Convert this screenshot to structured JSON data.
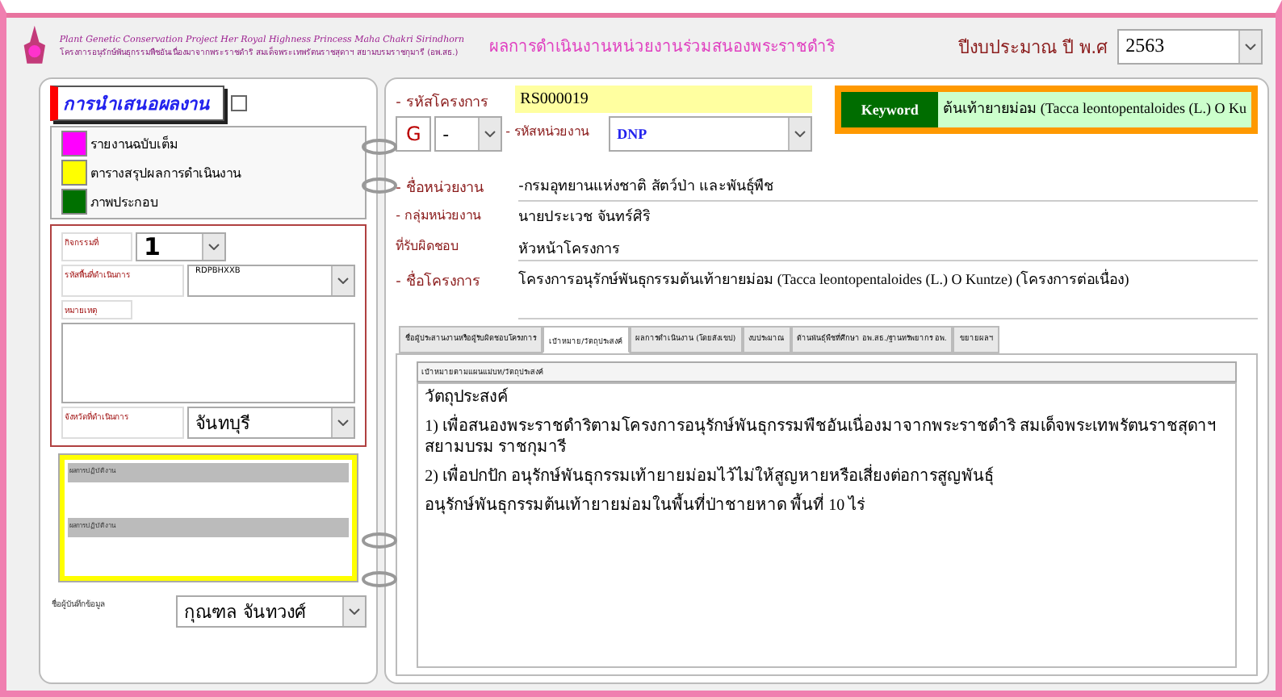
{
  "header": {
    "title_en": "Plant Genetic Conservation Project    Her Royal Highness Princess Maha Chakri Sirindhorn",
    "title_th": "โครงการอนุรักษ์พันธุกรรมพืชอันเนื่องมาจากพระราชดำริ สมเด็จพระเทพรัตนราชสุดาฯ สยามบรมราชกุมารี (อพ.สธ.)",
    "page_title": "ผลการดำเนินงานหน่วยงานร่วมสนองพระราชดำริ",
    "year_label": "ปีงบประมาณ ปี พ.ศ",
    "year": "2563"
  },
  "left": {
    "title": "การนำเสนอผลงาน",
    "checked": false,
    "legend": [
      {
        "label": "รายงานฉบับเต็ม",
        "color": "#ff00ff"
      },
      {
        "label": "ตารางสรุปผลการดำเนินงาน",
        "color": "#ffff00"
      },
      {
        "label": "ภาพประกอบ",
        "color": "#007000"
      }
    ],
    "activity_label": "กิจกรรมที่",
    "activity": "1",
    "area_label": "รหัสพื้นที่ดำเนินการ",
    "area": "RDPBHXXB",
    "note_label": "หมายเหตุ",
    "province_label": "จังหวัดที่ดำเนินการ",
    "province": "จันทบุรี",
    "panel_labels": [
      "ผลการปฏิบัติงาน",
      "ผลการปฏิบัติงาน"
    ],
    "recorder_label": "ชื่อผู้บันทึกข้อมูล",
    "recorder": "กุณฑล จันทวงศ์"
  },
  "right": {
    "code_label": "- รหัสโครงการ",
    "code": "RS000019",
    "g": "G",
    "g_value": "-",
    "unit_code_label": "- รหัสหน่วยงาน",
    "unit_code": "DNP",
    "keyword_label": "Keyword",
    "keyword": "ต้นเท้ายายม่อม (Tacca leontopentaloides (L.) O Ku",
    "unit_name_label": "- ชื่อหน่วยงาน",
    "unit_name": "-กรมอุทยานแห่งชาติ สัตว์ป่า และพันธุ์พืช",
    "group_label_1": "- กลุ่มหน่วยงาน",
    "group_label_2": "ที่รับผิดชอบ",
    "person": "นายประเวช จันทร์ศิริ",
    "role": "หัวหน้าโครงการ",
    "project_label": "- ชื่อโครงการ",
    "project": "โครงการอนุรักษ์พันธุกรรมต้นเท้ายายม่อม (Tacca leontopentaloides (L.) O Kuntze) (โครงการต่อเนื่อง)",
    "tabs": [
      {
        "label": "ชื่อผู้ประสานงานหรือผู้รับผิดชอบโครงการ",
        "selected": false
      },
      {
        "label": "เป้าหมาย/วัตถุประสงค์",
        "selected": true
      },
      {
        "label": "ผลการดำเนินงาน (โดยสังเขป)",
        "selected": false
      },
      {
        "label": "งบประมาณ",
        "selected": false
      },
      {
        "label": "ด้านพันธุ์พืชที่ศึกษา อพ.สธ./ฐานทรัพยากร อพ.",
        "selected": false
      },
      {
        "label": "ขยายผลฯ",
        "selected": false
      }
    ],
    "section_label": "เป้าหมายตามแผนแม่บท/วัตถุประสงค์",
    "body": [
      "วัตถุประสงค์",
      "1) เพื่อสนองพระราชดำริตามโครงการอนุรักษ์พันธุกรรมพืชอันเนื่องมาจากพระราชดำริ สมเด็จพระเทพรัตนราชสุดาฯสยามบรม ราชกุมารี",
      "2) เพื่อปกปัก อนุรักษ์พันธุกรรมเท้ายายม่อมไว้ไม่ให้สูญหายหรือเสี่ยงต่อการสูญพันธุ์",
      "อนุรักษ์พันธุกรรมต้นเท้ายายม่อมในพื้นที่ป่าชายหาด พื้นที่ 10 ไร่"
    ]
  }
}
